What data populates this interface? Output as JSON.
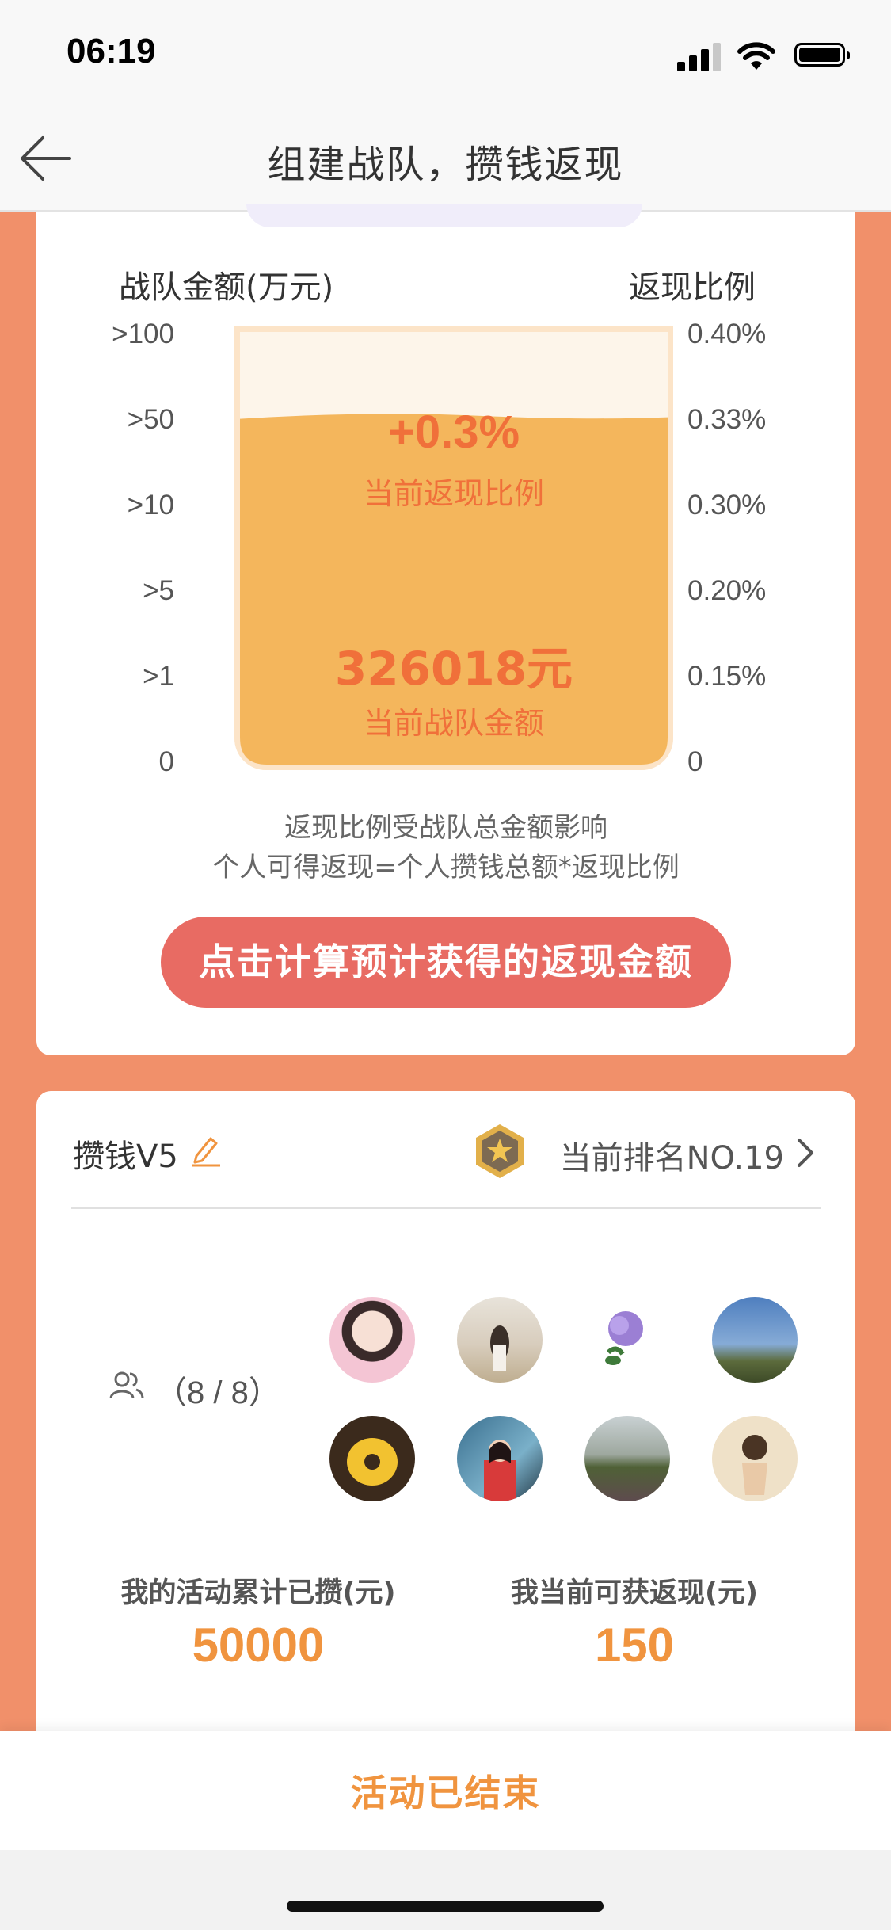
{
  "status_bar": {
    "time": "06:19"
  },
  "nav": {
    "title": "组建战队，攒钱返现"
  },
  "card_chart": {
    "left_column_label": "战队金额(万元)",
    "right_column_label": "返现比例",
    "left_ticks": [
      ">100",
      ">50",
      ">10",
      ">5",
      ">1",
      "0"
    ],
    "right_ticks": [
      "0.40%",
      "0.33%",
      "0.30%",
      "0.20%",
      "0.15%",
      "0"
    ],
    "current_rate": "+0.3%",
    "current_rate_label": "当前返现比例",
    "current_amount": "326018元",
    "current_amount_label": "当前战队金额",
    "fill_fraction": 0.8,
    "note_line1": "返现比例受战队总金额影响",
    "note_line2": "个人可得返现=个人攒钱总额*返现比例",
    "calc_button_label": "点击计算预计获得的返现金额"
  },
  "card_team": {
    "team_name": "攒钱V5",
    "rank_text": "当前排名NO.19",
    "members_count": "（8 / 8）",
    "stat_saved_label": "我的活动累计已攒(元)",
    "stat_saved_value": "50000",
    "stat_cashback_label": "我当前可获返现(元)",
    "stat_cashback_value": "150"
  },
  "bottom": {
    "status_label": "活动已结束"
  },
  "colors": {
    "background": "#f1906a",
    "accent_orange": "#f0943f",
    "rate_text": "#f0703a",
    "beaker_fill": "#f4b65c",
    "button_red": "#e86b63"
  }
}
